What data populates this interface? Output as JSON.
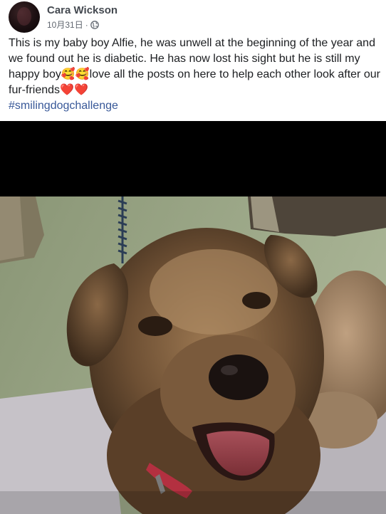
{
  "post": {
    "author": "Cara Wickson",
    "date": "10月31日",
    "separator": "·",
    "privacy_icon": "globe-icon",
    "text": "This is my baby boy Alfie, he was unwell at the beginning of the year and we found out he is diabetic. He has now lost his sight but he is still my happy boy🥰🥰love all the posts on here to help each other look after our fur-friends❤️❤️",
    "hashtag": "#smilingdogchallenge"
  },
  "colors": {
    "author": "#444950",
    "meta": "#616770",
    "text": "#1c1e21",
    "hashtag": "#385898",
    "photo_letterbox": "#000000"
  }
}
